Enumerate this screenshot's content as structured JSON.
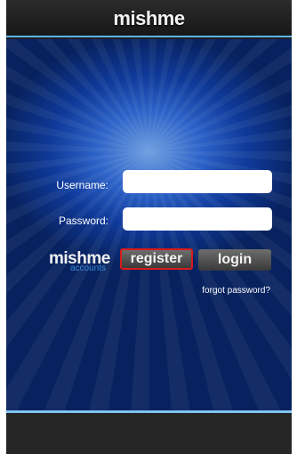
{
  "header": {
    "logo_text": "mishme",
    "logo_dot_char": "ı"
  },
  "login": {
    "username_label": "Username:",
    "username_value": "",
    "password_label": "Password:",
    "password_value": ""
  },
  "brand": {
    "name": "mishme",
    "subtitle": "accounts"
  },
  "actions": {
    "register_label": "register",
    "login_label": "login",
    "forgot_label": "forgot password?"
  },
  "colors": {
    "accent_blue": "#5bb4e8",
    "panel_blue": "#0f3a9a",
    "register_outline": "#d81b1b"
  }
}
